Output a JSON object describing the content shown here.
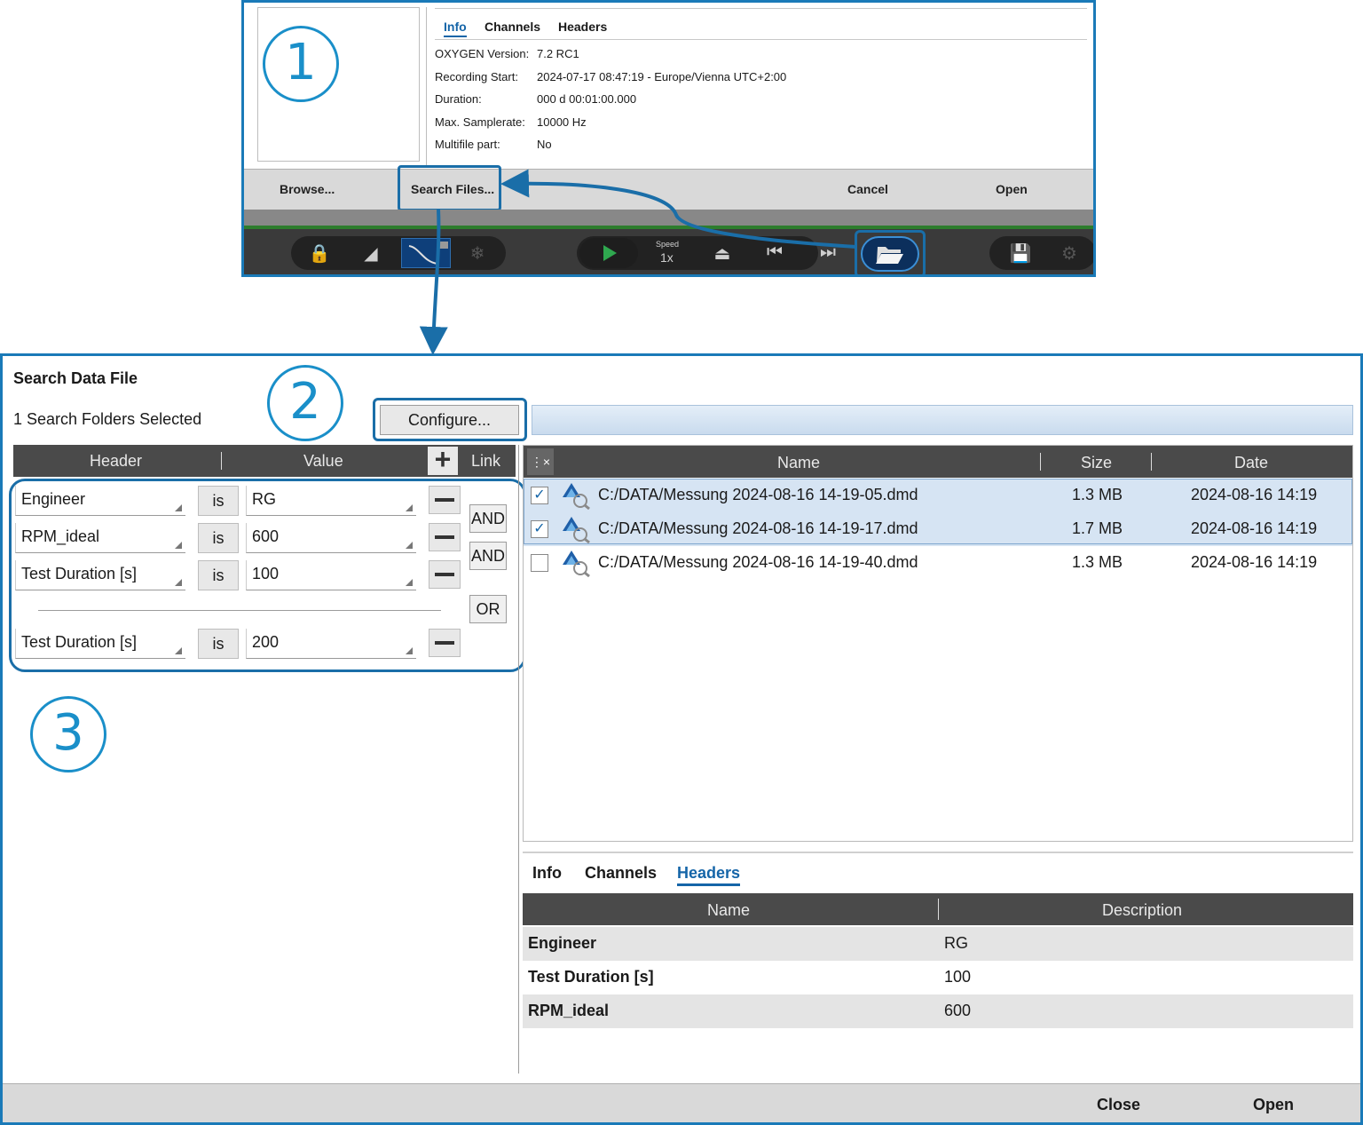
{
  "top_dialog": {
    "tabs": [
      "Info",
      "Channels",
      "Headers"
    ],
    "active_tab": "Info",
    "info": [
      {
        "key": "OXYGEN Version:",
        "value": "7.2 RC1"
      },
      {
        "key": "Recording Start:",
        "value": "2024-07-17 08:47:19 - Europe/Vienna UTC+2:00"
      },
      {
        "key": "Duration:",
        "value": "000 d 00:01:00.000"
      },
      {
        "key": "Max. Samplerate:",
        "value": "10000 Hz"
      },
      {
        "key": "Multifile part:",
        "value": "No"
      }
    ],
    "buttons": {
      "browse": "Browse...",
      "search_files": "Search Files...",
      "cancel": "Cancel",
      "open": "Open"
    },
    "toolbar": {
      "speed_label": "Speed",
      "speed_value": "1x",
      "icons": [
        "lock-icon",
        "ruler-icon",
        "curve-cursor-icon",
        "snowflake-icon",
        "play-icon",
        "eject-icon",
        "skip-start-icon",
        "skip-end-icon",
        "open-folder-icon",
        "save-icon",
        "settings-icon"
      ]
    }
  },
  "callouts": [
    "1",
    "2",
    "3"
  ],
  "search_dialog": {
    "title": "Search Data File",
    "folders_label": "1 Search Folders Selected",
    "configure_label": "Configure...",
    "filter_columns": {
      "header": "Header",
      "value": "Value",
      "link": "Link"
    },
    "filters": [
      {
        "header": "Engineer",
        "op": "is",
        "value": "RG"
      },
      {
        "header": "RPM_ideal",
        "op": "is",
        "value": "600"
      },
      {
        "header": "Test Duration [s]",
        "op": "is",
        "value": "100"
      },
      {
        "header": "Test Duration [s]",
        "op": "is",
        "value": "200"
      }
    ],
    "links": [
      "AND",
      "AND",
      "OR"
    ],
    "file_columns": {
      "name": "Name",
      "size": "Size",
      "date": "Date"
    },
    "files": [
      {
        "checked": true,
        "name": "C:/DATA/Messung 2024-08-16 14-19-05.dmd",
        "size": "1.3 MB",
        "date": "2024-08-16 14:19"
      },
      {
        "checked": true,
        "name": "C:/DATA/Messung 2024-08-16 14-19-17.dmd",
        "size": "1.7 MB",
        "date": "2024-08-16 14:19"
      },
      {
        "checked": false,
        "name": "C:/DATA/Messung 2024-08-16 14-19-40.dmd",
        "size": "1.3 MB",
        "date": "2024-08-16 14:19"
      }
    ],
    "detail_tabs": [
      "Info",
      "Channels",
      "Headers"
    ],
    "active_detail_tab": "Headers",
    "header_columns": {
      "name": "Name",
      "description": "Description"
    },
    "headers": [
      {
        "name": "Engineer",
        "description": "RG"
      },
      {
        "name": "Test Duration [s]",
        "description": "100"
      },
      {
        "name": "RPM_ideal",
        "description": "600"
      }
    ],
    "buttons": {
      "close": "Close",
      "open": "Open"
    }
  },
  "colors": {
    "accent": "#1a7ab8",
    "header_bg": "#4a4a4a",
    "selection": "#d6e4f3",
    "play_green": "#2fa84f"
  }
}
